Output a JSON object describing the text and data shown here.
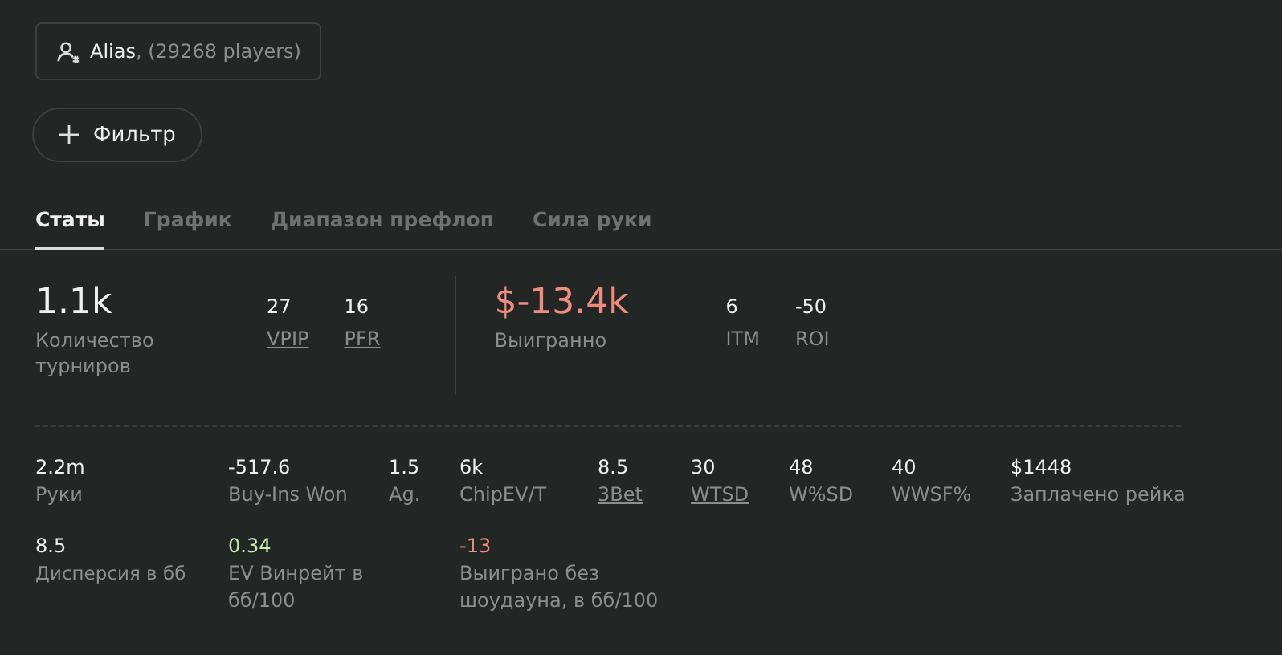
{
  "player_chip": {
    "name": "Alias",
    "count": ", (29268 players)"
  },
  "filter_button": {
    "label": "Фильтр"
  },
  "tabs": [
    {
      "label": "Статы",
      "selected": true
    },
    {
      "label": "График",
      "selected": false
    },
    {
      "label": "Диапазон префлоп",
      "selected": false
    },
    {
      "label": "Сила руки",
      "selected": false
    }
  ],
  "summary": {
    "left": [
      {
        "value": "1.1k",
        "label": "Количество турниров",
        "kind": "big",
        "color": "#f0f0f0",
        "underlined": false
      },
      {
        "value": "27",
        "label": "VPIP",
        "kind": "small",
        "color": "#f0f0f0",
        "underlined": true
      },
      {
        "value": "16",
        "label": "PFR",
        "kind": "small",
        "color": "#f0f0f0",
        "underlined": true
      }
    ],
    "right": [
      {
        "value": "$-13.4k",
        "label": "Выигранно",
        "kind": "big",
        "color": "#f08c7e",
        "underlined": false
      },
      {
        "value": "6",
        "label": "ITM",
        "kind": "small",
        "color": "#f0f0f0",
        "underlined": false
      },
      {
        "value": "-50",
        "label": "ROI",
        "kind": "small",
        "color": "#f0f0f0",
        "underlined": false
      }
    ]
  },
  "stats_rows": [
    [
      {
        "value": "2.2m",
        "label": "Руки",
        "color": "#f0f0f0",
        "underlined": false
      },
      {
        "value": "-517.6",
        "label": "Buy-Ins Won",
        "color": "#f0f0f0",
        "underlined": false
      },
      {
        "value": "1.5",
        "label": "Ag.",
        "color": "#f0f0f0",
        "underlined": false
      },
      {
        "value": "6k",
        "label": "ChipEV/T",
        "color": "#f0f0f0",
        "underlined": false
      },
      {
        "value": "8.5",
        "label": "3Bet",
        "color": "#f0f0f0",
        "underlined": true
      },
      {
        "value": "30",
        "label": "WTSD",
        "color": "#f0f0f0",
        "underlined": true
      },
      {
        "value": "48",
        "label": "W%SD",
        "color": "#f0f0f0",
        "underlined": false
      },
      {
        "value": "40",
        "label": "WWSF%",
        "color": "#f0f0f0",
        "underlined": false
      },
      {
        "value": "$1448",
        "label": "Заплачено рейка",
        "color": "#f0f0f0",
        "underlined": false
      }
    ],
    [
      {
        "value": "8.5",
        "label": "Дисперсия в бб",
        "color": "#f0f0f0",
        "underlined": false
      },
      {
        "value": "0.34",
        "label": "EV Винрейт в бб/100",
        "color": "#c7eab0",
        "underlined": false
      },
      {
        "value": "-13",
        "label": "Выиграно без шоудауна, в бб/100",
        "color": "#f08c7e",
        "underlined": false
      }
    ]
  ]
}
